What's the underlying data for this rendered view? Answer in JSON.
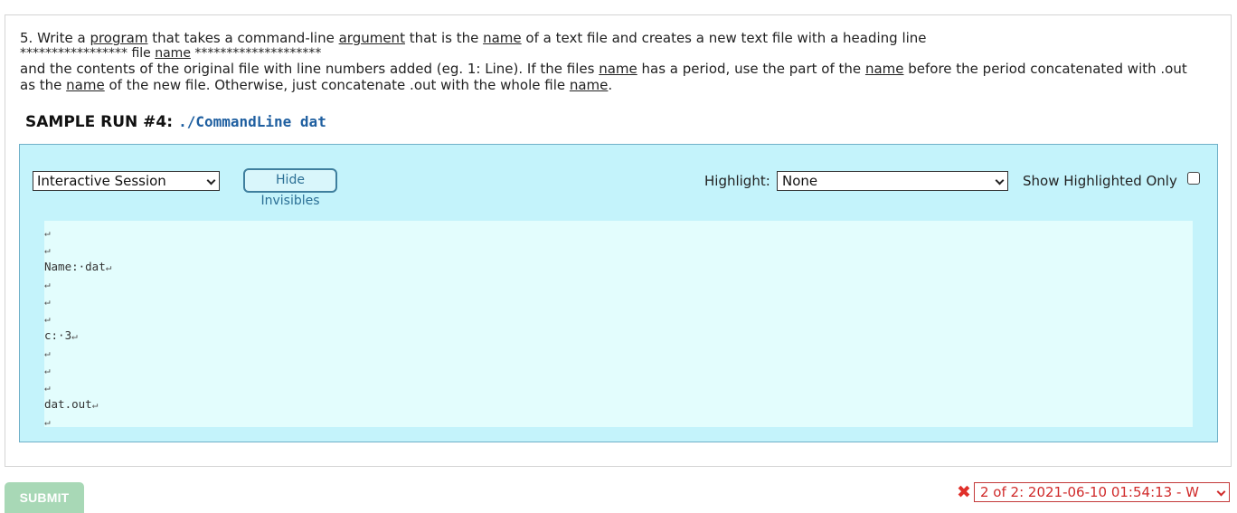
{
  "problem": {
    "number": "5.",
    "line1_parts": [
      "Write a ",
      "program",
      " that takes a command-line ",
      "argument",
      " that is the ",
      "name",
      " of a text file and creates a new text file with a heading line"
    ],
    "heading_stars_left": "*****************",
    "heading_word1": "file",
    "heading_word2": "name",
    "heading_stars_right": "********************",
    "para2_parts": [
      "and the contents of the original file with line numbers added (eg. 1: Line). If the files ",
      "name",
      " has a period, use the part of the ",
      "name",
      " before the period concatenated with .out"
    ],
    "para3_parts": [
      "as the ",
      "name",
      " of the new file. Otherwise, just concatenate .out with the whole file ",
      "name",
      "."
    ]
  },
  "sample": {
    "title": "SAMPLE RUN #4:",
    "command": "./CommandLine dat"
  },
  "controls": {
    "session_value": "Interactive Session",
    "hide_invisibles_label": "Hide Invisibles",
    "highlight_label": "Highlight:",
    "highlight_value": "None",
    "show_highlighted_label": "Show Highlighted Only",
    "show_highlighted_checked": false
  },
  "output_lines": [
    "",
    "",
    "Name:·dat",
    "",
    "",
    "",
    "c:·3",
    "",
    "",
    "",
    "dat.out",
    ""
  ],
  "return_glyph": "↵",
  "footer": {
    "submit_label": "SUBMIT",
    "error_icon": "close-icon",
    "version_value": "2 of 2: 2021-06-10 01:54:13 - W"
  },
  "colors": {
    "session_bg": "#c4f3fb",
    "output_bg": "#e3fdfd",
    "command_color": "#1f5fa0",
    "error_color": "#e0302a",
    "submit_bg": "#a8d8b6"
  }
}
